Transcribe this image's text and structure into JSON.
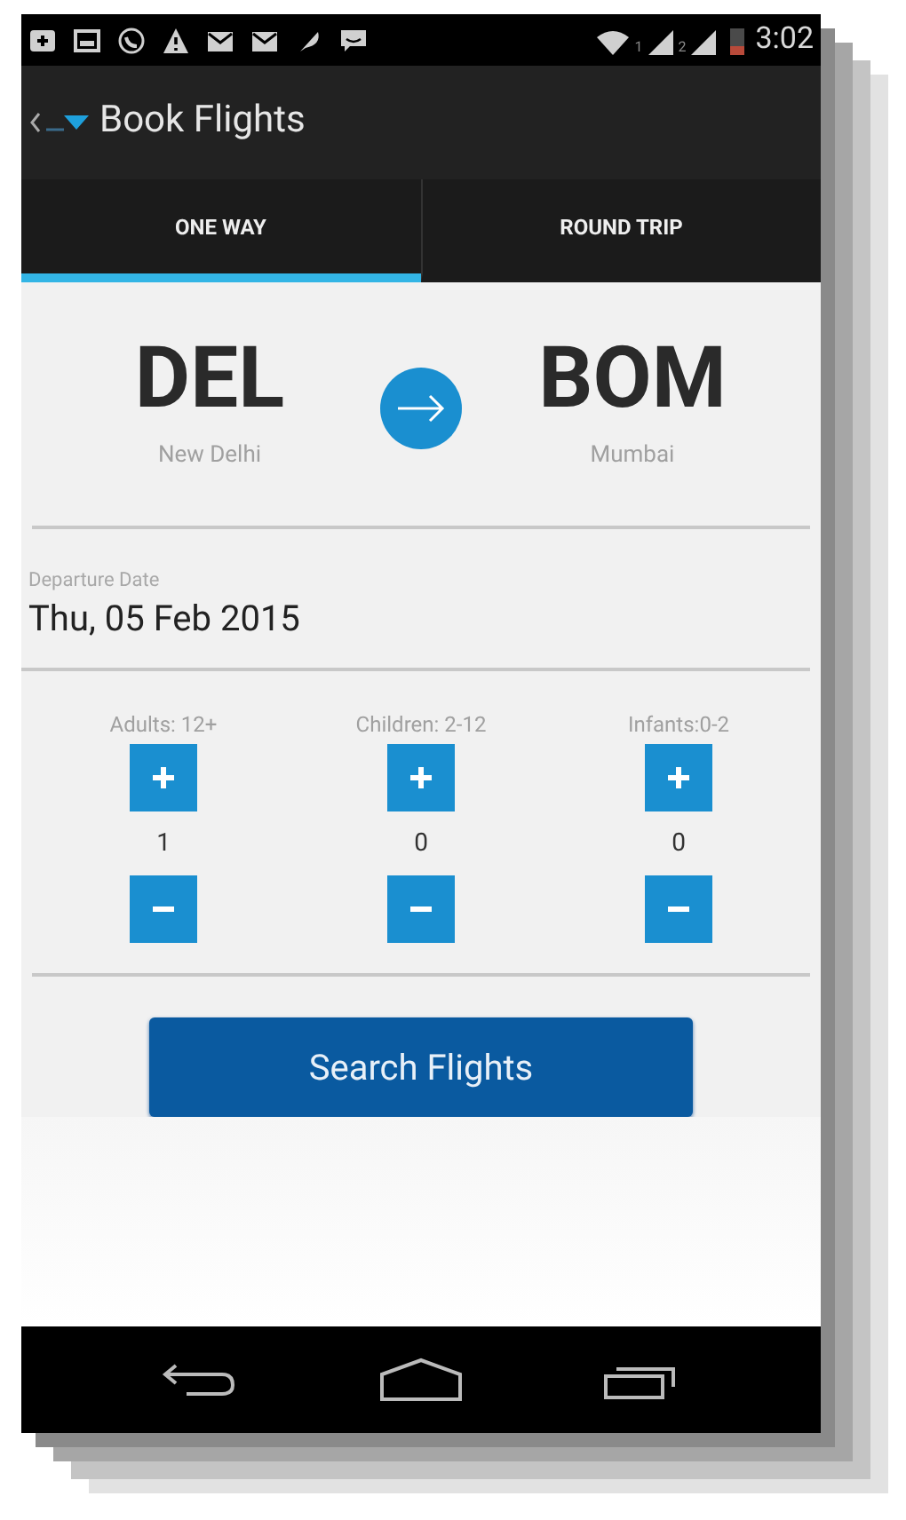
{
  "status_bar": {
    "sim_labels": [
      "1",
      "2"
    ],
    "time": "3:02"
  },
  "app_bar": {
    "title": "Book Flights"
  },
  "tabs": [
    {
      "label": "ONE WAY",
      "selected": true
    },
    {
      "label": "ROUND TRIP",
      "selected": false
    }
  ],
  "route": {
    "from": {
      "code": "DEL",
      "city": "New Delhi"
    },
    "to": {
      "code": "BOM",
      "city": "Mumbai"
    }
  },
  "departure": {
    "label": "Departure Date",
    "value": "Thu, 05 Feb 2015"
  },
  "passengers": [
    {
      "label": "Adults: 12+",
      "count": "1"
    },
    {
      "label": "Children: 2-12",
      "count": "0"
    },
    {
      "label": "Infants:0-2",
      "count": "0"
    }
  ],
  "search_button": "Search Flights"
}
